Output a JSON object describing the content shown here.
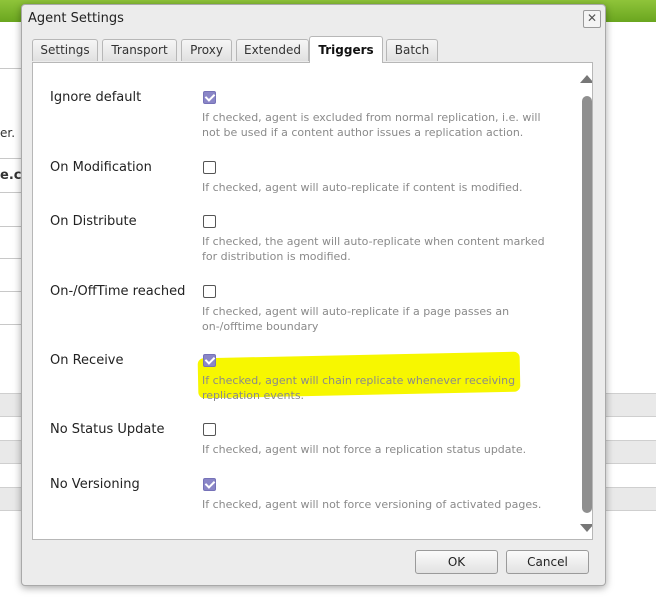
{
  "background": {
    "fragment_1": "er.",
    "fragment_2": "e.c"
  },
  "dialog": {
    "title": "Agent Settings",
    "close_symbol": "✕",
    "tabs": [
      {
        "label": "Settings",
        "active": false
      },
      {
        "label": "Transport",
        "active": false
      },
      {
        "label": "Proxy",
        "active": false
      },
      {
        "label": "Extended",
        "active": false
      },
      {
        "label": "Triggers",
        "active": true
      },
      {
        "label": "Batch",
        "active": false
      }
    ],
    "triggers": [
      {
        "label": "Ignore default",
        "checked": true,
        "desc_lines": [
          "If checked, agent is excluded from normal replication, i.e. will",
          "not be used if a content author issues a replication action."
        ]
      },
      {
        "label": "On Modification",
        "checked": false,
        "desc_lines": [
          "If checked, agent will auto-replicate if content is modified."
        ]
      },
      {
        "label": "On Distribute",
        "checked": false,
        "desc_lines": [
          "If checked, the agent will auto-replicate when content marked",
          "for distribution is modified."
        ]
      },
      {
        "label": "On-/OffTime reached",
        "checked": false,
        "desc_lines": [
          "If checked, agent will auto-replicate if a page passes an",
          "on-/offtime boundary"
        ]
      },
      {
        "label": "On Receive",
        "checked": true,
        "highlighted": true,
        "desc_lines": [
          "If checked, agent will chain replicate whenever receiving",
          "replication events."
        ]
      },
      {
        "label": "No Status Update",
        "checked": false,
        "desc_lines": [
          "If checked, agent will not force a replication status update."
        ]
      },
      {
        "label": "No Versioning",
        "checked": true,
        "desc_lines": [
          "If checked, agent will not force versioning of activated pages."
        ]
      }
    ],
    "highlight_color": "#f7f700",
    "checkbox_checked_color": "#8a86c7",
    "ok_label": "OK",
    "cancel_label": "Cancel"
  }
}
